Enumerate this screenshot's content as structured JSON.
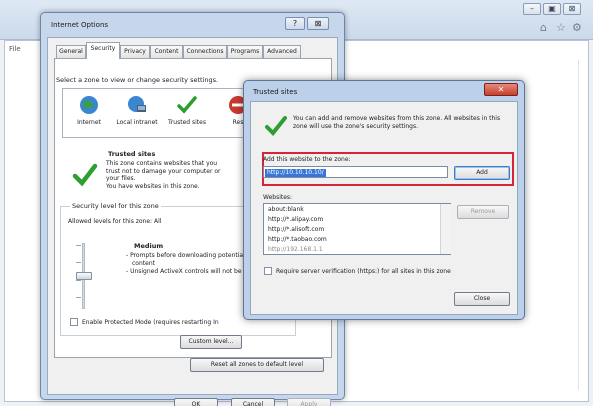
{
  "browser": {
    "menu_file": "File",
    "window_buttons": [
      "–",
      "▣",
      "⊠"
    ]
  },
  "internet_options": {
    "title": "Internet Options",
    "help_glyph": "?",
    "close_glyph": "⊠",
    "tabs": [
      {
        "label": "General",
        "selected": false
      },
      {
        "label": "Security",
        "selected": true
      },
      {
        "label": "Privacy",
        "selected": false
      },
      {
        "label": "Content",
        "selected": false
      },
      {
        "label": "Connections",
        "selected": false
      },
      {
        "label": "Programs",
        "selected": false
      },
      {
        "label": "Advanced",
        "selected": false
      }
    ],
    "zone_prompt": "Select a zone to view or change security settings.",
    "zones": [
      {
        "label": "Internet",
        "icon": "globe-icon"
      },
      {
        "label": "Local intranet",
        "icon": "network-computer-icon"
      },
      {
        "label": "Trusted sites",
        "icon": "check-icon"
      },
      {
        "label": "Res",
        "icon": "restricted-icon"
      }
    ],
    "trusted_heading": "Trusted sites",
    "trusted_desc_lines": [
      "This zone contains websites that you",
      "trust not to damage your computer or",
      "your files.",
      "You have websites in this zone."
    ],
    "security_level_label": "Security level for this zone",
    "allowed_levels": "Allowed levels for this zone: All",
    "level_title": "Medium",
    "level_desc1": "- Prompts before downloading potentia",
    "level_desc1b": "content",
    "level_desc2": "- Unsigned ActiveX controls will not be",
    "protected_mode_label": "Enable Protected Mode (requires restarting In",
    "custom_level": "Custom level...",
    "reset_all": "Reset all zones to default level",
    "ok": "OK",
    "cancel": "Cancel",
    "apply": "Apply",
    "slider_level_fraction": 0.5
  },
  "trusted_sites": {
    "title": "Trusted sites",
    "close_glyph": "✕",
    "description": "You can add and remove websites from this zone. All websites in this zone will use the zone's security settings.",
    "add_label": "Add this website to the zone:",
    "add_value": "http://10.10.10.10/",
    "add_button": "Add",
    "websites_label": "Websites:",
    "websites": [
      "about:blank",
      "http://*.alipay.com",
      "http://*.alisoft.com",
      "http://*.taobao.com",
      "http://192.168.1.1"
    ],
    "remove_button": "Remove",
    "verify_label": "Require server verification (https:) for all sites in this zone",
    "close_button": "Close"
  },
  "colors": {
    "highlight_frame": "#d52638",
    "selection": "#3875d7",
    "check_green": "#2e9e2e"
  }
}
